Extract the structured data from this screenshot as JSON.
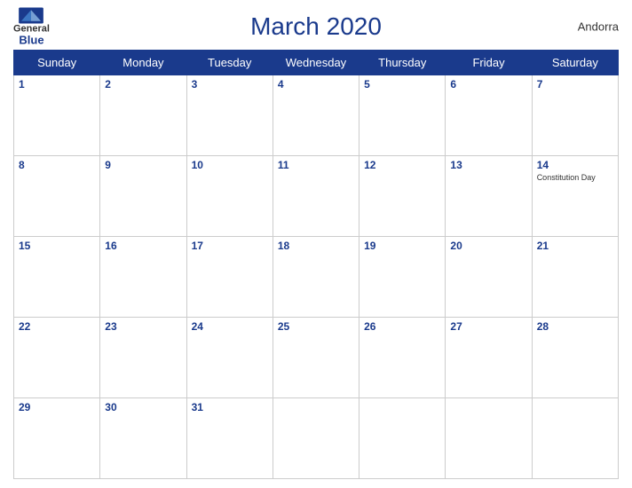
{
  "header": {
    "title": "March 2020",
    "country": "Andorra",
    "logo_general": "General",
    "logo_blue": "Blue"
  },
  "days_of_week": [
    "Sunday",
    "Monday",
    "Tuesday",
    "Wednesday",
    "Thursday",
    "Friday",
    "Saturday"
  ],
  "weeks": [
    [
      {
        "day": 1,
        "events": []
      },
      {
        "day": 2,
        "events": []
      },
      {
        "day": 3,
        "events": []
      },
      {
        "day": 4,
        "events": []
      },
      {
        "day": 5,
        "events": []
      },
      {
        "day": 6,
        "events": []
      },
      {
        "day": 7,
        "events": []
      }
    ],
    [
      {
        "day": 8,
        "events": []
      },
      {
        "day": 9,
        "events": []
      },
      {
        "day": 10,
        "events": []
      },
      {
        "day": 11,
        "events": []
      },
      {
        "day": 12,
        "events": []
      },
      {
        "day": 13,
        "events": []
      },
      {
        "day": 14,
        "events": [
          "Constitution Day"
        ]
      }
    ],
    [
      {
        "day": 15,
        "events": []
      },
      {
        "day": 16,
        "events": []
      },
      {
        "day": 17,
        "events": []
      },
      {
        "day": 18,
        "events": []
      },
      {
        "day": 19,
        "events": []
      },
      {
        "day": 20,
        "events": []
      },
      {
        "day": 21,
        "events": []
      }
    ],
    [
      {
        "day": 22,
        "events": []
      },
      {
        "day": 23,
        "events": []
      },
      {
        "day": 24,
        "events": []
      },
      {
        "day": 25,
        "events": []
      },
      {
        "day": 26,
        "events": []
      },
      {
        "day": 27,
        "events": []
      },
      {
        "day": 28,
        "events": []
      }
    ],
    [
      {
        "day": 29,
        "events": []
      },
      {
        "day": 30,
        "events": []
      },
      {
        "day": 31,
        "events": []
      },
      {
        "day": null,
        "events": []
      },
      {
        "day": null,
        "events": []
      },
      {
        "day": null,
        "events": []
      },
      {
        "day": null,
        "events": []
      }
    ]
  ]
}
